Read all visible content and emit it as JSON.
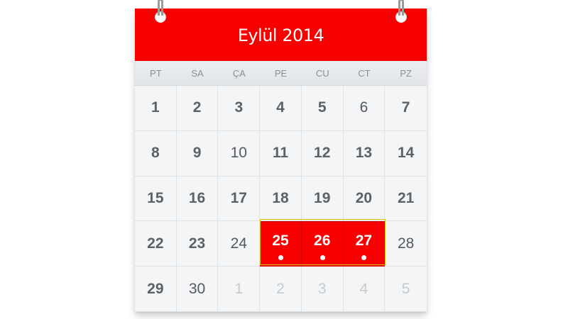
{
  "calendar": {
    "title": "Eylül 2014",
    "weekdays": [
      "PT",
      "SA",
      "ÇA",
      "PE",
      "CU",
      "CT",
      "PZ"
    ],
    "days": [
      {
        "label": "1",
        "state": "normal"
      },
      {
        "label": "2",
        "state": "normal"
      },
      {
        "label": "3",
        "state": "normal"
      },
      {
        "label": "4",
        "state": "normal"
      },
      {
        "label": "5",
        "state": "normal"
      },
      {
        "label": "6",
        "state": "regular"
      },
      {
        "label": "7",
        "state": "normal"
      },
      {
        "label": "8",
        "state": "normal"
      },
      {
        "label": "9",
        "state": "normal"
      },
      {
        "label": "10",
        "state": "regular"
      },
      {
        "label": "11",
        "state": "normal"
      },
      {
        "label": "12",
        "state": "normal"
      },
      {
        "label": "13",
        "state": "normal"
      },
      {
        "label": "14",
        "state": "normal"
      },
      {
        "label": "15",
        "state": "normal"
      },
      {
        "label": "16",
        "state": "normal"
      },
      {
        "label": "17",
        "state": "normal"
      },
      {
        "label": "18",
        "state": "normal"
      },
      {
        "label": "19",
        "state": "normal"
      },
      {
        "label": "20",
        "state": "normal"
      },
      {
        "label": "21",
        "state": "normal"
      },
      {
        "label": "22",
        "state": "normal"
      },
      {
        "label": "23",
        "state": "normal"
      },
      {
        "label": "24",
        "state": "regular"
      },
      {
        "label": "25",
        "state": "event"
      },
      {
        "label": "26",
        "state": "event"
      },
      {
        "label": "27",
        "state": "event"
      },
      {
        "label": "28",
        "state": "regular"
      },
      {
        "label": "29",
        "state": "normal"
      },
      {
        "label": "30",
        "state": "regular"
      },
      {
        "label": "1",
        "state": "muted"
      },
      {
        "label": "2",
        "state": "muted"
      },
      {
        "label": "3",
        "state": "muted"
      },
      {
        "label": "4",
        "state": "muted"
      },
      {
        "label": "5",
        "state": "muted"
      }
    ]
  },
  "colors": {
    "accent": "#f70000",
    "background": "#f3f5f7",
    "text": "#5c6166",
    "muted_text": "#c6cacd"
  }
}
